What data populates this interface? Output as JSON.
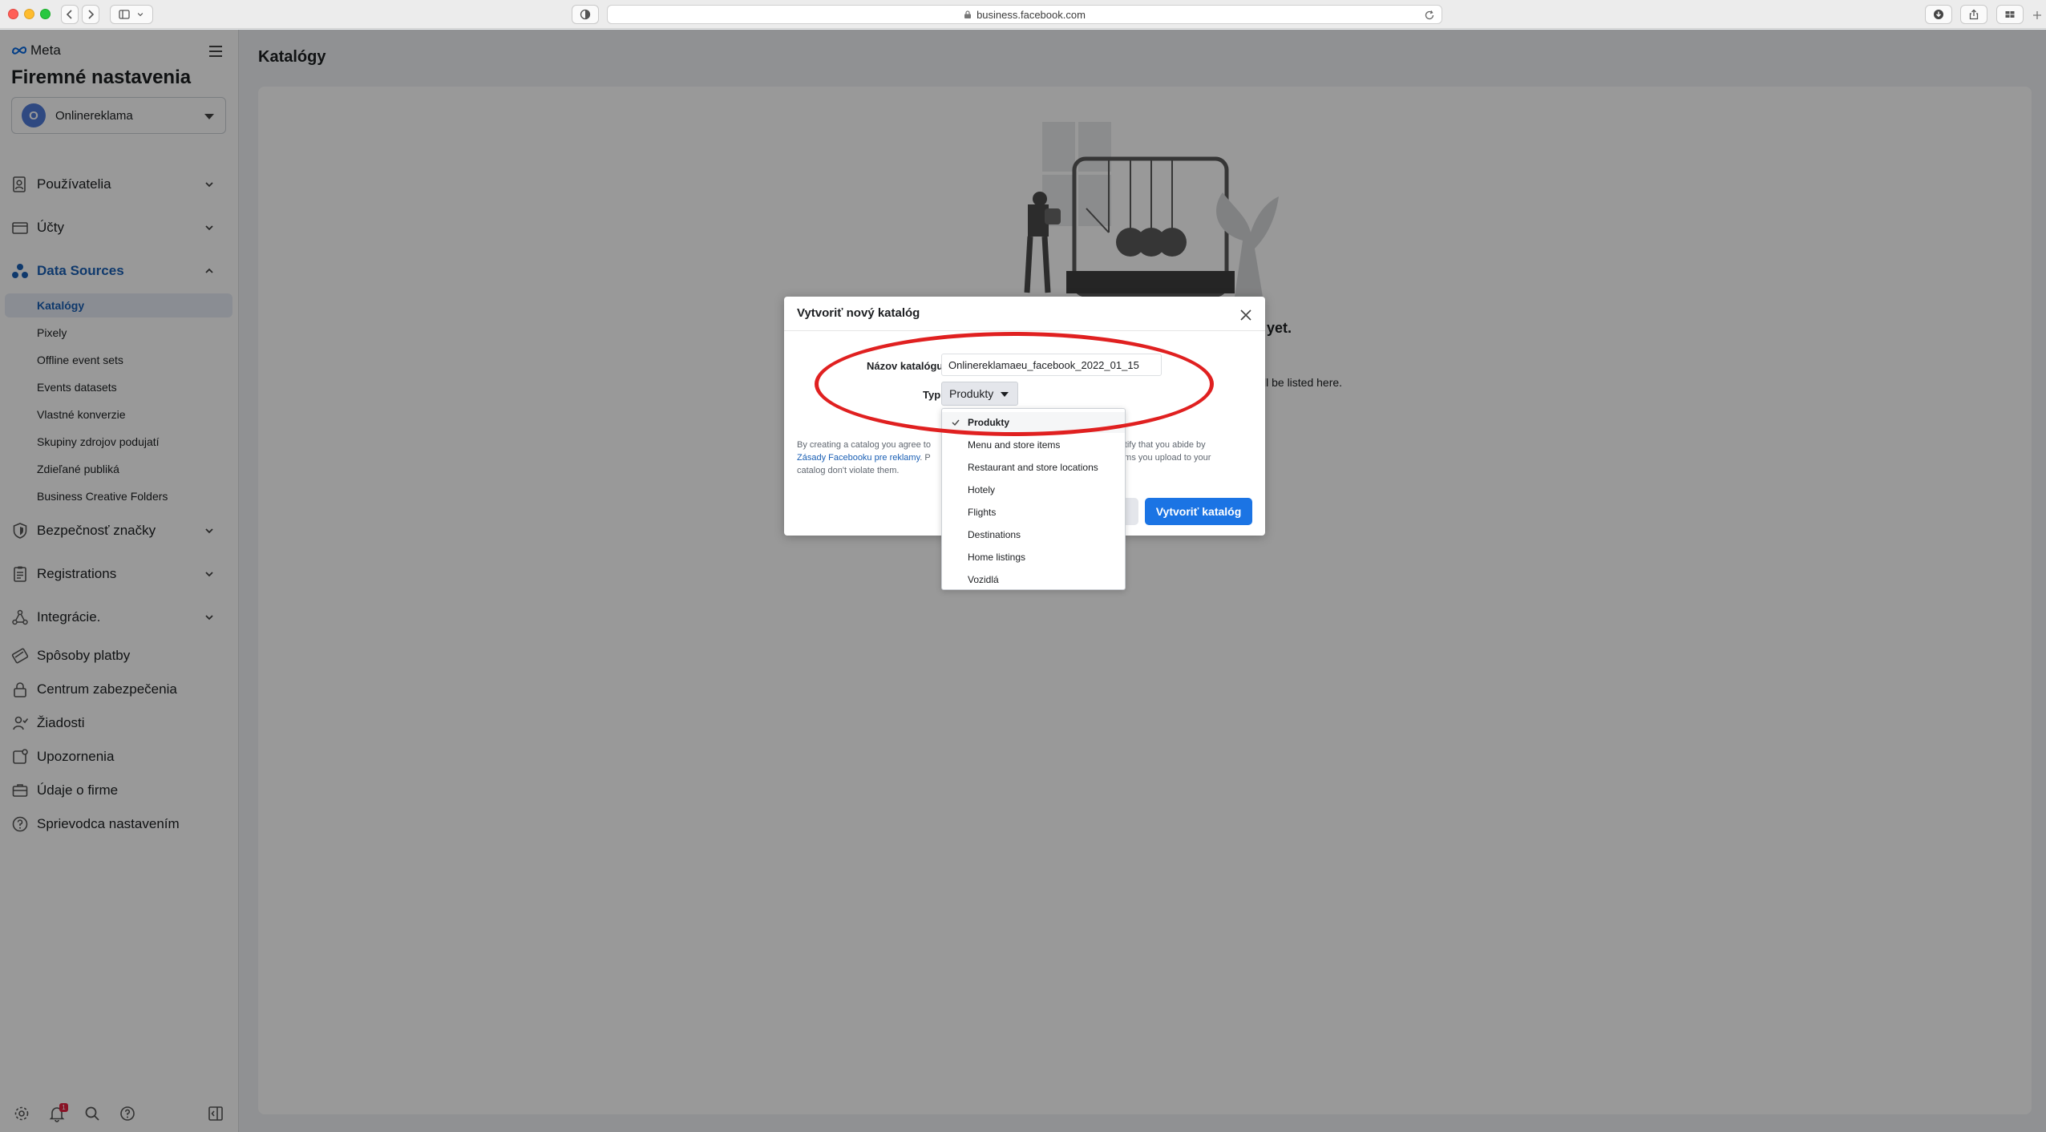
{
  "browser": {
    "url": "business.facebook.com"
  },
  "sidebar": {
    "brand": "Meta",
    "title": "Firemné nastavenia",
    "account": {
      "initial": "O",
      "name": "Onlinereklama"
    },
    "sections": [
      {
        "label": "Používatelia",
        "icon": "users-icon"
      },
      {
        "label": "Účty",
        "icon": "accounts-icon"
      },
      {
        "label": "Data Sources",
        "icon": "data-sources-icon"
      }
    ],
    "data_sources_items": [
      {
        "label": "Katalógy",
        "selected": true
      },
      {
        "label": "Pixely"
      },
      {
        "label": "Offline event sets"
      },
      {
        "label": "Events datasets"
      },
      {
        "label": "Vlastné konverzie"
      },
      {
        "label": "Skupiny zdrojov podujatí"
      },
      {
        "label": "Zdieľané publiká"
      },
      {
        "label": "Business Creative Folders"
      }
    ],
    "more_sections": [
      {
        "label": "Bezpečnosť značky",
        "icon": "shield-icon"
      },
      {
        "label": "Registrations",
        "icon": "clipboard-icon"
      },
      {
        "label": "Integrácie.",
        "icon": "integrations-icon"
      }
    ],
    "links": [
      {
        "label": "Spôsoby platby",
        "icon": "credit-card-icon"
      },
      {
        "label": "Centrum zabezpečenia",
        "icon": "lock-icon"
      },
      {
        "label": "Žiadosti",
        "icon": "requests-icon"
      },
      {
        "label": "Upozornenia",
        "icon": "notifications-icon"
      },
      {
        "label": "Údaje o firme",
        "icon": "briefcase-icon"
      },
      {
        "label": "Sprievodca nastavením",
        "icon": "help-icon"
      }
    ],
    "footer": {
      "notification_count": "1"
    }
  },
  "main": {
    "title": "Katalógy",
    "empty_title": "yet.",
    "empty_text": "ll be listed here."
  },
  "modal": {
    "title": "Vytvoriť nový katalóg",
    "name_label": "Názov katalógu",
    "name_value": "Onlinereklamaeu_facebook_2022_01_15",
    "type_label": "Typ",
    "type_value": "Produkty",
    "legal_line1a": "By creating a catalog you agree to",
    "legal_line1b": "ertify that you abide by",
    "legal_link": "Zásady Facebooku pre reklamy",
    "legal_line2a": ". P",
    "legal_line2b": "tems you upload to your",
    "legal_line3": "catalog don't violate them.",
    "create_button": "Vytvoriť katalóg"
  },
  "dropdown": {
    "options": [
      "Produkty",
      "Menu and store items",
      "Restaurant and store locations",
      "Hotely",
      "Flights",
      "Destinations",
      "Home listings",
      "Vozidlá"
    ],
    "selected": "Produkty"
  },
  "colors": {
    "accent": "#1b74e4",
    "active_nav": "#1a5fb4",
    "annotation": "#e02020"
  }
}
